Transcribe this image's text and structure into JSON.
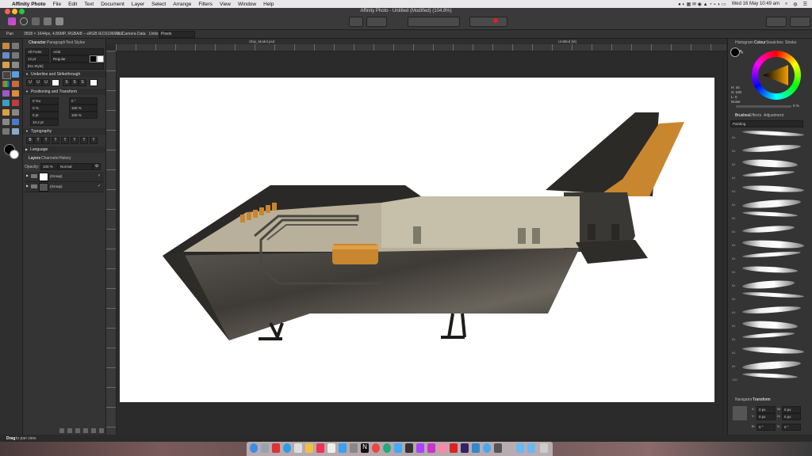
{
  "menubar": {
    "app_name": "Affinity Photo",
    "items": [
      "File",
      "Edit",
      "Text",
      "Document",
      "Layer",
      "Select",
      "Arrange",
      "Filters",
      "View",
      "Window",
      "Help"
    ],
    "clock": "Wed 16 May  10:49 am"
  },
  "window": {
    "title": "Affinity Photo - Untitled (Modified) (104.8%)"
  },
  "context_bar": {
    "tool": "Pan",
    "doc_info": "3508 × 1644px, 4.86MP, RGBA/8 – sRGB IEC61966-2.1",
    "camera": "No Camera Data",
    "units_label": "Units:",
    "units_value": "Pixels"
  },
  "doc_tabs": {
    "left": "Ship_Model.psd",
    "center": "Untitled [M]"
  },
  "left_panel": {
    "tabs": [
      "Character",
      "Paragraph",
      "Text Styles"
    ],
    "font_collection": "All Fonts",
    "font_family": "Arial",
    "font_size": "12 pt",
    "font_weight": "Regular",
    "style": "[No Style]",
    "section_underline": "Underline and Strikethrough",
    "section_position": "Positioning and Transform",
    "pos_fields": [
      "0 %o",
      "0 %",
      "0 pt",
      "10.4 pt"
    ],
    "pos_fields_right": [
      "0 °",
      "100 %",
      "100 %"
    ],
    "section_typography": "Typography",
    "section_language": "Language",
    "layers_tabs": [
      "Layers",
      "Channels",
      "History"
    ],
    "opacity_label": "Opacity:",
    "opacity_value": "100 %",
    "blend_mode": "Normal",
    "layers": [
      {
        "name": "(Group)"
      },
      {
        "name": "(Group)"
      }
    ]
  },
  "right_panel": {
    "tabs_top": [
      "Histogram",
      "Colour",
      "Swatches",
      "Stroke"
    ],
    "color_values": [
      "H: 44",
      "S: 100",
      "L: 0"
    ],
    "noise_label": "Noise",
    "noise_value": "0 %",
    "brush_tabs": [
      "Brushes",
      "Effects",
      "Adjustment"
    ],
    "brush_category": "Painting",
    "brush_sizes": [
      "64",
      "64",
      "64",
      "64",
      "64",
      "64",
      "64",
      "64",
      "64",
      "64",
      "64",
      "64",
      "64",
      "64",
      "64",
      "64",
      "64",
      "64",
      "100"
    ],
    "nav_tabs": [
      "Navigator",
      "Transform"
    ],
    "transform_fields": [
      "X:",
      "Y:",
      "W:",
      "H:",
      "R:",
      "S:"
    ],
    "transform_values": [
      "0 px",
      "0 px",
      "0 px",
      "0 px",
      "0 °",
      "0 °"
    ]
  },
  "statusbar": {
    "hint_bold": "Drag",
    "hint_rest": " to pan view."
  },
  "colors": {
    "accent_orange": "#d88c2a",
    "hull_tan": "#c2b8a0",
    "hull_dark": "#2b2a28",
    "canvas_bg": "#ffffff"
  }
}
